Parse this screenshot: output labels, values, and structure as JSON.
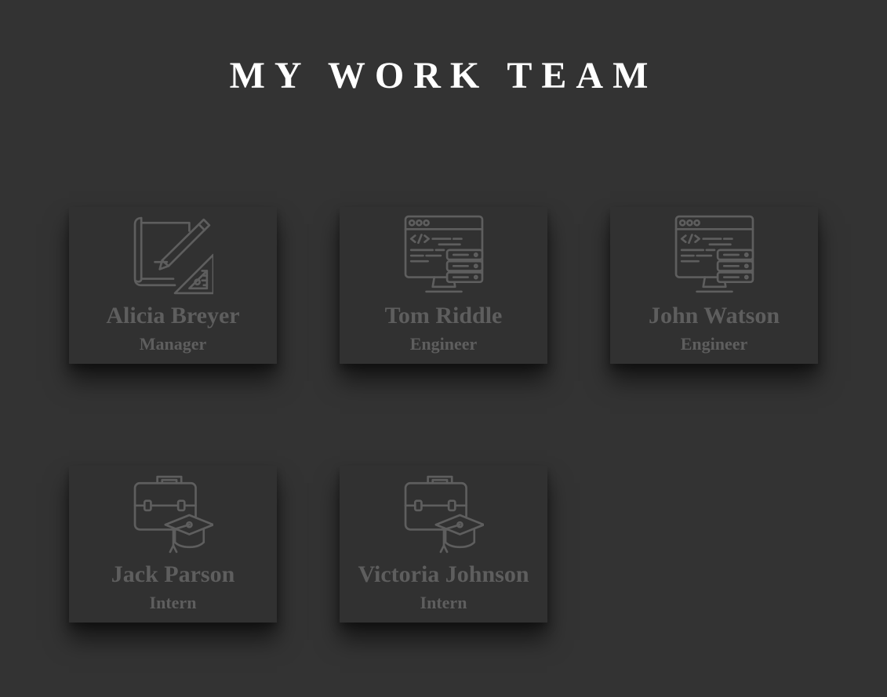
{
  "page": {
    "title": "MY WORK TEAM",
    "background_color": "#333333",
    "card_text_color": "#5e5e5e",
    "icon_color": "#5e5e5e"
  },
  "team": [
    {
      "name": "Alicia Breyer",
      "role": "Manager",
      "icon": "blueprint-pencil-ruler-icon"
    },
    {
      "name": "Tom Riddle",
      "role": "Engineer",
      "icon": "code-monitor-server-icon"
    },
    {
      "name": "John Watson",
      "role": "Engineer",
      "icon": "code-monitor-server-icon"
    },
    {
      "name": "Jack Parson",
      "role": "Intern",
      "icon": "briefcase-graduation-cap-icon"
    },
    {
      "name": "Victoria Johnson",
      "role": "Intern",
      "icon": "briefcase-graduation-cap-icon"
    }
  ]
}
